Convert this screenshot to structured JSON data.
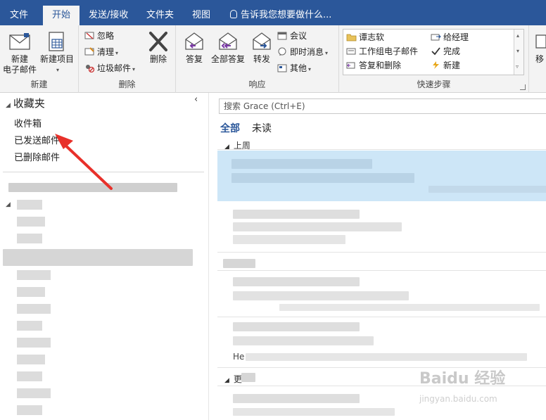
{
  "tabs": {
    "file": "文件",
    "home": "开始",
    "send_receive": "发送/接收",
    "folder": "文件夹",
    "view": "视图",
    "tell_me": "告诉我您想要做什么..."
  },
  "ribbon": {
    "new_group": {
      "label": "新建",
      "new_email_line1": "新建",
      "new_email_line2": "电子邮件",
      "new_items": "新建项目"
    },
    "delete_group": {
      "label": "删除",
      "ignore": "忽略",
      "cleanup": "清理",
      "junk": "垃圾邮件",
      "delete": "删除"
    },
    "respond_group": {
      "label": "响应",
      "reply": "答复",
      "reply_all": "全部答复",
      "forward": "转发",
      "meeting": "会议",
      "im": "即时消息",
      "more": "其他"
    },
    "quick_steps": {
      "label": "快速步骤",
      "items": [
        "谭志软",
        "给经理",
        "工作组电子邮件",
        "完成",
        "答复和删除",
        "新建"
      ]
    },
    "move_partial": "移"
  },
  "folder_pane": {
    "favorites": "收藏夹",
    "folders": [
      "收件箱",
      "已发送邮件",
      "已删除邮件"
    ]
  },
  "message_list": {
    "search_placeholder": "搜索 Grace (Ctrl+E)",
    "filter_all": "全部",
    "filter_unread": "未读",
    "group_last_week": "上周",
    "group_earlier": "更",
    "preview_prefix": "He"
  },
  "watermark": {
    "brand": "Baidu 经验",
    "url": "jingyan.baidu.com"
  },
  "colors": {
    "accent": "#2b579a",
    "ribbon_bg": "#f3f3f3",
    "selection": "#cde6f7",
    "arrow": "#e8302a"
  }
}
